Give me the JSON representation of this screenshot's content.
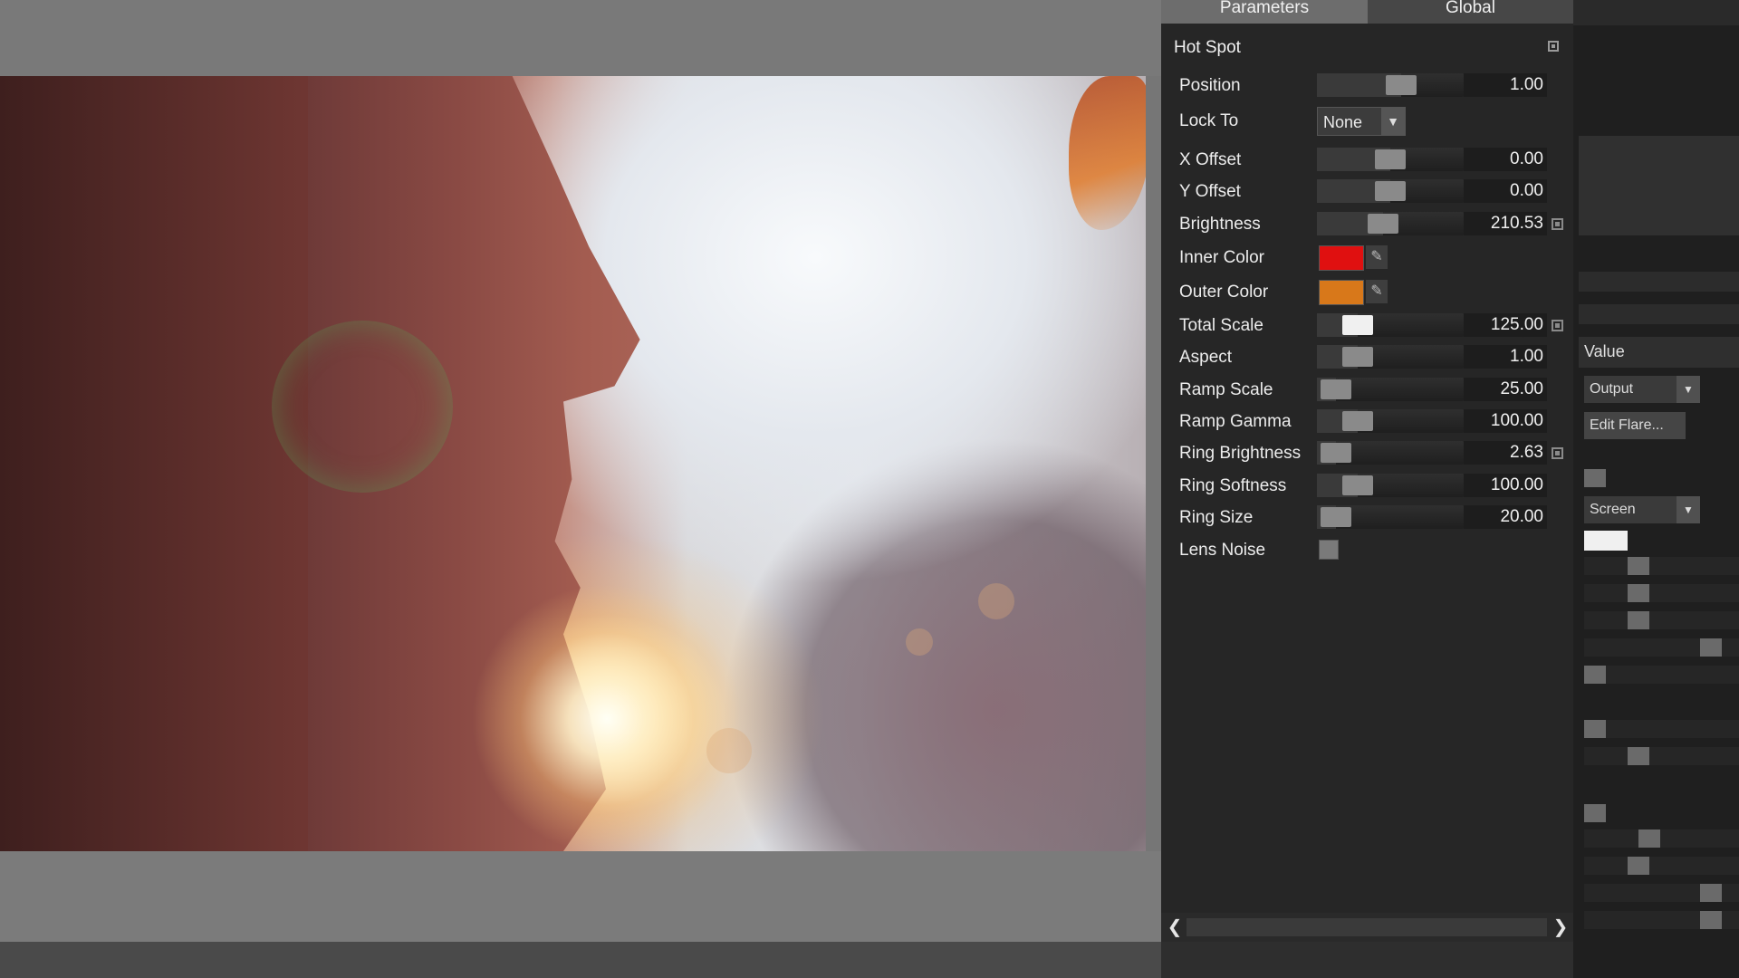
{
  "tabs": {
    "parameters": "Parameters",
    "global": "Global"
  },
  "section": {
    "title": "Hot Spot"
  },
  "params": {
    "position": {
      "label": "Position",
      "value": "1.00",
      "level": 0.6
    },
    "lock_to": {
      "label": "Lock To",
      "selected": "None"
    },
    "x_offset": {
      "label": "X Offset",
      "value": "0.00",
      "level": 0.5
    },
    "y_offset": {
      "label": "Y Offset",
      "value": "0.00",
      "level": 0.5
    },
    "brightness": {
      "label": "Brightness",
      "value": "210.53",
      "level": 0.43
    },
    "inner_color": {
      "label": "Inner Color",
      "color": "#e01010"
    },
    "outer_color": {
      "label": "Outer Color",
      "color": "#d8781a"
    },
    "total_scale": {
      "label": "Total Scale",
      "value": "125.00",
      "level": 0.2
    },
    "aspect": {
      "label": "Aspect",
      "value": "1.00",
      "level": 0.2
    },
    "ramp_scale": {
      "label": "Ramp Scale",
      "value": "25.00",
      "level": 0.0
    },
    "ramp_gamma": {
      "label": "Ramp Gamma",
      "value": "100.00",
      "level": 0.2
    },
    "ring_brightness": {
      "label": "Ring Brightness",
      "value": "2.63",
      "level": 0.0
    },
    "ring_softness": {
      "label": "Ring Softness",
      "value": "100.00",
      "level": 0.2
    },
    "ring_size": {
      "label": "Ring Size",
      "value": "20.00",
      "level": 0.0
    },
    "lens_noise": {
      "label": "Lens Noise"
    }
  },
  "side": {
    "value_header": "Value",
    "output_dropdown": "Output",
    "edit_flare_button": "Edit Flare...",
    "blend_dropdown": "Screen"
  },
  "icons": {
    "scroll_left": "chevron-left-icon",
    "scroll_right": "chevron-right-icon",
    "dropdown": "chevron-down-icon",
    "eyedropper": "eyedropper-icon",
    "keyframe": "keyframe-icon"
  }
}
